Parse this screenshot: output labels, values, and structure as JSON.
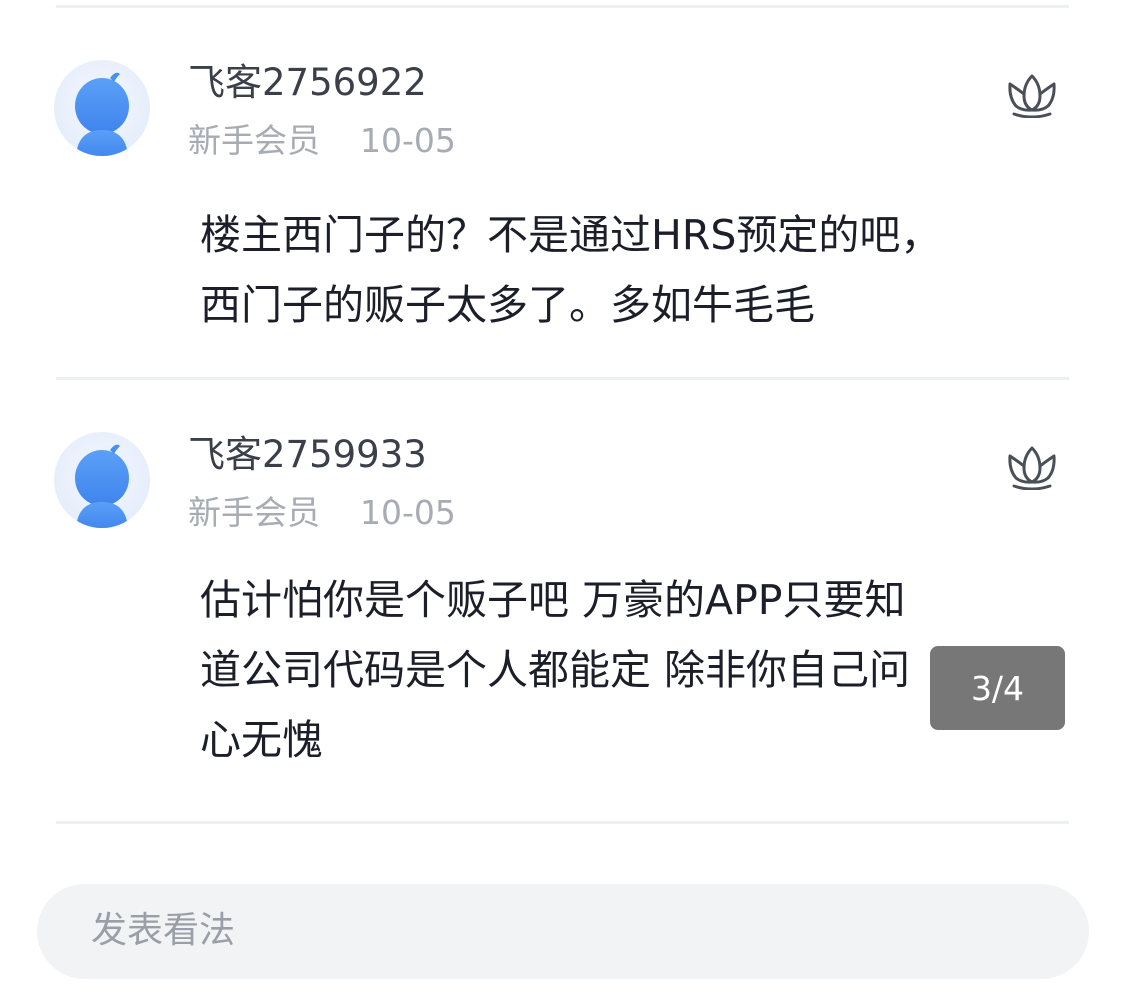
{
  "comments": [
    {
      "username": "飞客2756922",
      "level": "新手会员",
      "date": "10-05",
      "avatar_icon": "default-avatar-icon",
      "like_icon": "lotus-like-icon",
      "text_lines": [
        "楼主西门子的？不是通过HRS预定的吧，",
        "西门子的贩子太多了。多如牛毛毛"
      ]
    },
    {
      "username": "飞客2759933",
      "level": "新手会员",
      "date": "10-05",
      "avatar_icon": "default-avatar-icon",
      "like_icon": "lotus-like-icon",
      "text_lines": [
        "估计怕你是个贩子吧 万豪的APP只要知",
        "道公司代码是个人都能定 除非你自己问",
        "心无愧"
      ]
    }
  ],
  "image_viewer": {
    "page_indicator": "3/4"
  },
  "compose": {
    "placeholder": "发表看法"
  },
  "colors": {
    "avatar_blue": "#4a8ff0",
    "text_dark": "#1c1f2a",
    "text_muted": "#a7abb3",
    "divider": "#eeeff2",
    "input_bg": "#f2f3f5"
  }
}
